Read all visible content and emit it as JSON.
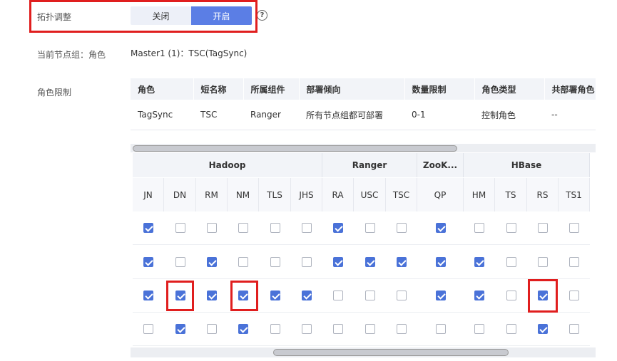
{
  "topology": {
    "label": "拓扑调整",
    "off_label": "关闭",
    "on_label": "开启",
    "help_icon": "?"
  },
  "current_group": {
    "label": "当前节点组：角色",
    "value": "Master1 (1)：TSC(TagSync)"
  },
  "role_limit": {
    "label": "角色限制",
    "headers": [
      "角色",
      "短名称",
      "所属组件",
      "部署倾向",
      "数量限制",
      "角色类型",
      "共部署角色"
    ],
    "row": [
      "TagSync",
      "TSC",
      "Ranger",
      "所有节点组都可部署",
      "0-1",
      "控制角色",
      "--"
    ]
  },
  "grid": {
    "groups": [
      {
        "name": "Hadoop",
        "span": 6
      },
      {
        "name": "Ranger",
        "span": 3
      },
      {
        "name": "ZooK...",
        "span": 1
      },
      {
        "name": "HBase",
        "span": 4
      }
    ],
    "columns": [
      "JN",
      "DN",
      "RM",
      "NM",
      "TLS",
      "JHS",
      "RA",
      "USC",
      "TSC",
      "QP",
      "HM",
      "TS",
      "RS",
      "TS1"
    ],
    "rows": [
      [
        true,
        false,
        false,
        false,
        false,
        false,
        true,
        false,
        false,
        true,
        false,
        false,
        false,
        false
      ],
      [
        true,
        false,
        true,
        false,
        false,
        false,
        true,
        true,
        true,
        true,
        true,
        false,
        false,
        false
      ],
      [
        true,
        true,
        true,
        true,
        true,
        true,
        false,
        false,
        false,
        true,
        true,
        false,
        true,
        false
      ],
      [
        false,
        true,
        false,
        true,
        false,
        false,
        false,
        false,
        false,
        false,
        false,
        false,
        true,
        false
      ]
    ]
  },
  "colors": {
    "accent": "#5b7ee5",
    "checkbox": "#4a72d8",
    "highlight": "#e01e1e"
  }
}
